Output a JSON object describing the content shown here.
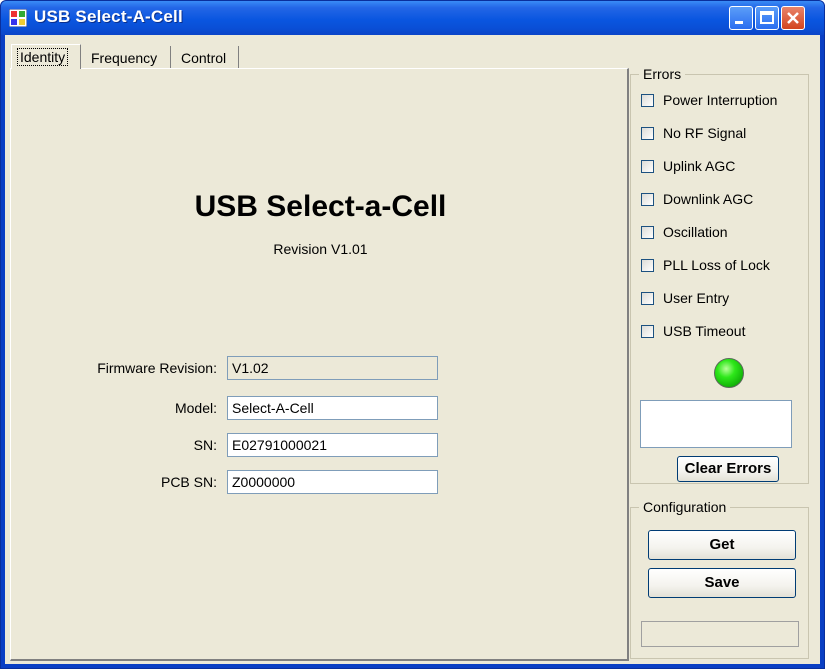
{
  "window": {
    "title": "USB Select-A-Cell"
  },
  "tabs": [
    {
      "label": "Identity",
      "active": true
    },
    {
      "label": "Frequency",
      "active": false
    },
    {
      "label": "Control",
      "active": false
    }
  ],
  "identity": {
    "title": "USB Select-a-Cell",
    "revision": "Revision V1.01",
    "fields": [
      {
        "label": "Firmware Revision:",
        "value": "V1.02",
        "readonly": true
      },
      {
        "label": "Model:",
        "value": "Select-A-Cell",
        "readonly": false
      },
      {
        "label": "SN:",
        "value": "E02791000021",
        "readonly": false
      },
      {
        "label": "PCB SN:",
        "value": "Z0000000",
        "readonly": false
      }
    ]
  },
  "errors": {
    "title": "Errors",
    "items": [
      {
        "label": "Power Interruption",
        "checked": false
      },
      {
        "label": "No RF Signal",
        "checked": false
      },
      {
        "label": "Uplink AGC",
        "checked": false
      },
      {
        "label": "Downlink AGC",
        "checked": false
      },
      {
        "label": "Oscillation",
        "checked": false
      },
      {
        "label": "PLL Loss of Lock",
        "checked": false
      },
      {
        "label": "User Entry",
        "checked": false
      },
      {
        "label": "USB Timeout",
        "checked": false
      }
    ],
    "status_led_color": "#2ee81a",
    "clear_button": "Clear Errors"
  },
  "configuration": {
    "title": "Configuration",
    "get_button": "Get",
    "save_button": "Save"
  },
  "colors": {
    "titlebar": "#0a56e0",
    "client_background": "#ece9d8",
    "close_button": "#d3441e"
  }
}
